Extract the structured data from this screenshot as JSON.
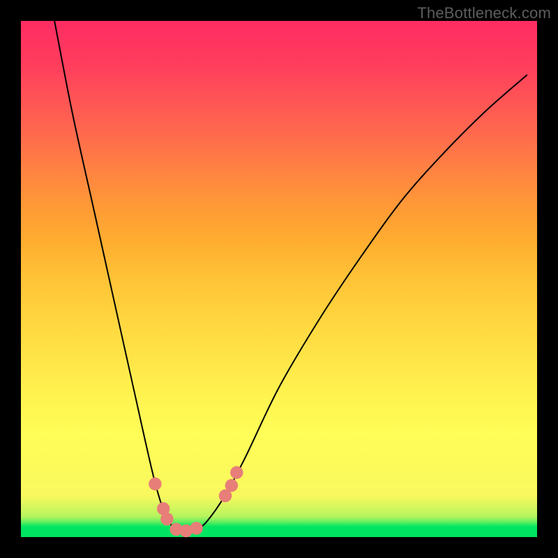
{
  "watermark": "TheBottleneck.com",
  "chart_data": {
    "type": "line",
    "title": "",
    "xlabel": "",
    "ylabel": "",
    "xlim": [
      0,
      1
    ],
    "ylim": [
      0,
      1
    ],
    "grid": false,
    "legend": false,
    "series": [
      {
        "name": "curve-1",
        "x": [
          0.065,
          0.1,
          0.14,
          0.18,
          0.22,
          0.255,
          0.275,
          0.29,
          0.305,
          0.32,
          0.34,
          0.36,
          0.395,
          0.435,
          0.5,
          0.58,
          0.66,
          0.74,
          0.82,
          0.9,
          0.98
        ],
        "y": [
          1.0,
          0.82,
          0.64,
          0.46,
          0.28,
          0.125,
          0.055,
          0.025,
          0.012,
          0.01,
          0.015,
          0.03,
          0.08,
          0.155,
          0.29,
          0.425,
          0.545,
          0.655,
          0.745,
          0.825,
          0.895
        ]
      }
    ],
    "markers": [
      {
        "x": 0.26,
        "y": 0.103
      },
      {
        "x": 0.276,
        "y": 0.055
      },
      {
        "x": 0.283,
        "y": 0.035
      },
      {
        "x": 0.301,
        "y": 0.015
      },
      {
        "x": 0.32,
        "y": 0.012
      },
      {
        "x": 0.34,
        "y": 0.017
      },
      {
        "x": 0.396,
        "y": 0.08
      },
      {
        "x": 0.408,
        "y": 0.1
      },
      {
        "x": 0.418,
        "y": 0.125
      }
    ],
    "marker_radius_fraction": 0.0125
  }
}
